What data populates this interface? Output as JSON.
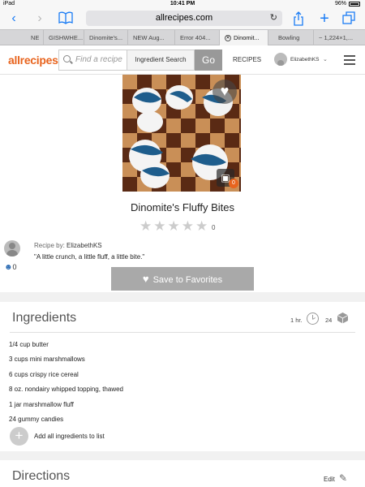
{
  "status_bar": {
    "device": "iPad",
    "time": "10:41 PM",
    "battery": "96%"
  },
  "browser": {
    "url": "allrecipes.com",
    "tabs": [
      {
        "label": "NE",
        "active": false
      },
      {
        "label": "GISHWHE...",
        "active": false
      },
      {
        "label": "Dinomite's...",
        "active": false
      },
      {
        "label": "NEW Aug...",
        "active": false
      },
      {
        "label": "Error 404...",
        "active": false
      },
      {
        "label": "Dinomit...",
        "active": true
      },
      {
        "label": "Bowling",
        "active": false
      },
      {
        "label": "~ 1,224×1,...",
        "active": false
      }
    ]
  },
  "site_header": {
    "logo": "allrecipes",
    "search_placeholder": "Find a recipe",
    "ingredient_search": "Ingredient Search",
    "go": "Go",
    "recipes": "RECIPES",
    "username": "ElizabethKS"
  },
  "recipe": {
    "title": "Dinomite's Fluffy Bites",
    "rating_count": "0",
    "stars": 0,
    "photo_count": "0",
    "recipe_by_label": "Recipe by:",
    "author": "ElizabethKS",
    "quote": "\"A little crunch, a little fluff, a little bite.\"",
    "followers": "0",
    "save_button": "Save to Favorites"
  },
  "ingredients": {
    "heading": "Ingredients",
    "time": "1 hr.",
    "servings": "24",
    "items": [
      "1/4 cup butter",
      "3 cups mini marshmallows",
      "6 cups crispy rice cereal",
      "8 oz. nondairy whipped topping, thawed",
      "1 jar marshmallow fluff",
      "24 gummy candies"
    ],
    "add_all": "Add all ingredients to list"
  },
  "directions": {
    "heading": "Directions",
    "edit": "Edit"
  },
  "colors": {
    "brand_orange": "#e8641e",
    "ios_blue": "#1a7cf5",
    "button_gray": "#a9a9a9"
  }
}
